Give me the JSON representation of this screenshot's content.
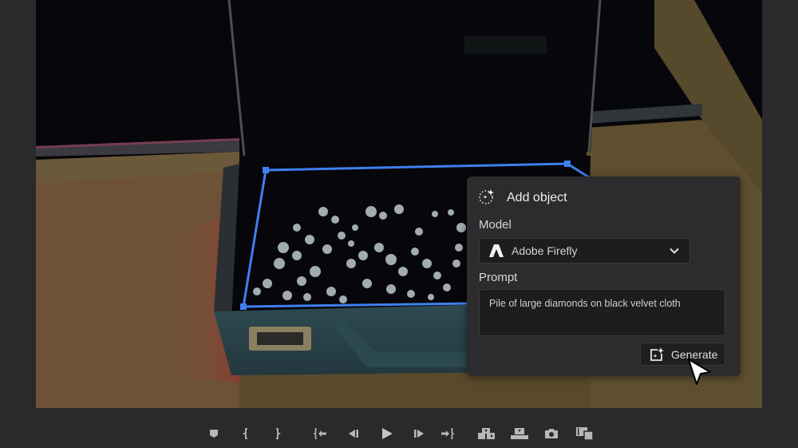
{
  "panel": {
    "title": "Add object",
    "title_icon": "sparkle-dotted-circle-icon",
    "model_label": "Model",
    "model_value": "Adobe Firefly",
    "model_icon": "adobe-firefly-logo-icon",
    "prompt_label": "Prompt",
    "prompt_value": "Pile of large diamonds on black velvet cloth",
    "generate_label": "Generate",
    "generate_icon": "generate-sparkle-icon"
  },
  "selection": {
    "color": "#3f7ff0"
  },
  "transport": {
    "buttons": [
      {
        "name": "add-marker-button",
        "icon": "marker-icon"
      },
      {
        "name": "mark-in-button",
        "icon": "mark-in-icon"
      },
      {
        "name": "mark-out-button",
        "icon": "mark-out-icon"
      },
      {
        "name": "go-to-in-button",
        "icon": "go-to-in-icon"
      },
      {
        "name": "step-back-button",
        "icon": "step-back-icon"
      },
      {
        "name": "play-button",
        "icon": "play-icon"
      },
      {
        "name": "step-forward-button",
        "icon": "step-forward-icon"
      },
      {
        "name": "go-to-out-button",
        "icon": "go-to-out-icon"
      },
      {
        "name": "insert-button",
        "icon": "insert-icon"
      },
      {
        "name": "overwrite-button",
        "icon": "overwrite-icon"
      },
      {
        "name": "export-frame-button",
        "icon": "camera-icon"
      },
      {
        "name": "compare-view-button",
        "icon": "compare-view-icon"
      }
    ]
  }
}
